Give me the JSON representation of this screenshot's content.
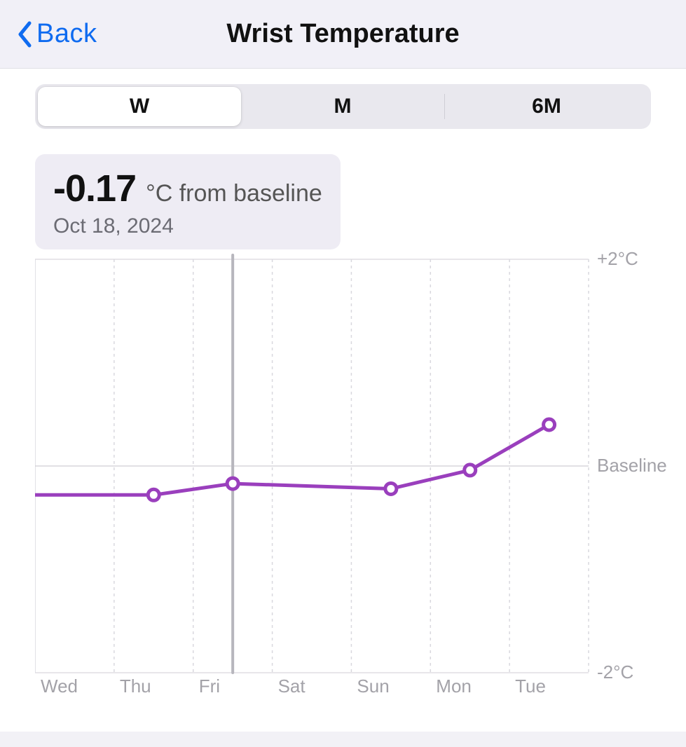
{
  "nav": {
    "back_label": "Back",
    "title": "Wrist Temperature"
  },
  "segments": {
    "items": [
      "W",
      "M",
      "6M"
    ],
    "selected_index": 0
  },
  "callout": {
    "value": "-0.17",
    "unit": "°C from baseline",
    "date": "Oct 18, 2024"
  },
  "chart_data": {
    "type": "line",
    "categories": [
      "Wed",
      "Thu",
      "Fri",
      "Sat",
      "Sun",
      "Mon",
      "Tue"
    ],
    "series": [
      {
        "name": "Wrist Temperature",
        "values": [
          -0.28,
          -0.28,
          -0.17,
          null,
          -0.22,
          -0.04,
          0.4
        ]
      }
    ],
    "ylabel": "°C from baseline",
    "ylim": [
      -2,
      2
    ],
    "y_ticks": [
      {
        "value": 2,
        "label": "+2°C"
      },
      {
        "value": 0,
        "label": "Baseline"
      },
      {
        "value": -2,
        "label": "-2°C"
      }
    ],
    "highlight_index": 2,
    "highlight_date": "Oct 18, 2024",
    "line_color": "#9a3fbd"
  }
}
